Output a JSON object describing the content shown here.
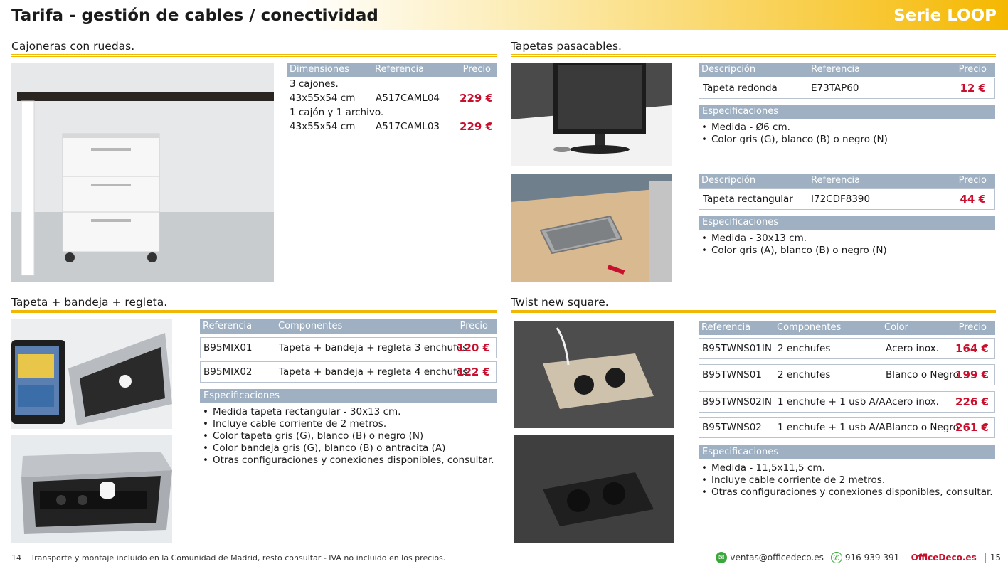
{
  "header": {
    "title": "Tarifa - gestión de cables / conectividad",
    "series": "Serie LOOP"
  },
  "cajoneras": {
    "title": "Cajoneras con ruedas.",
    "headers": {
      "dim": "Dimensiones",
      "ref": "Referencia",
      "price": "Precio"
    },
    "rows": [
      {
        "desc": "3 cajones.",
        "dims": "43x55x54 cm",
        "ref": "A517CAML04",
        "price": "229 €"
      },
      {
        "desc": "1 cajón y 1 archivo.",
        "dims": "43x55x54 cm",
        "ref": "A517CAML03",
        "price": "229 €"
      }
    ]
  },
  "tapetas": {
    "title": "Tapetas pasacables.",
    "headers": {
      "desc": "Descripción",
      "ref": "Referencia",
      "price": "Precio"
    },
    "spec_label": "Especificaciones",
    "items": [
      {
        "desc": "Tapeta redonda",
        "ref": "E73TAP60",
        "price": "12 €",
        "specs": [
          "Medida - Ø6 cm.",
          "Color gris (G), blanco (B) o negro (N)"
        ]
      },
      {
        "desc": "Tapeta rectangular",
        "ref": "I72CDF8390",
        "price": "44 €",
        "specs": [
          "Medida - 30x13 cm.",
          "Color gris (A), blanco (B) o negro (N)"
        ]
      }
    ]
  },
  "bandeja": {
    "title": "Tapeta + bandeja + regleta.",
    "headers": {
      "ref": "Referencia",
      "comp": "Componentes",
      "price": "Precio"
    },
    "rows": [
      {
        "ref": "B95MIX01",
        "comp": "Tapeta + bandeja + regleta 3 enchufes",
        "price": "120 €"
      },
      {
        "ref": "B95MIX02",
        "comp": "Tapeta + bandeja + regleta 4 enchufes",
        "price": "122 €"
      }
    ],
    "spec_label": "Especificaciones",
    "specs": [
      "Medida tapeta rectangular - 30x13 cm.",
      "Incluye cable corriente de 2 metros.",
      "Color tapeta gris (G), blanco (B) o negro (N)",
      "Color bandeja gris (G), blanco (B) o antracita (A)",
      "Otras configuraciones y conexiones disponibles, consultar."
    ]
  },
  "twist": {
    "title": "Twist new square.",
    "headers": {
      "ref": "Referencia",
      "comp": "Componentes",
      "color": "Color",
      "price": "Precio"
    },
    "rows": [
      {
        "ref": "B95TWNS01IN",
        "comp": "2 enchufes",
        "color": "Acero inox.",
        "price": "164 €"
      },
      {
        "ref": "B95TWNS01",
        "comp": "2 enchufes",
        "color": "Blanco o Negro",
        "price": "199 €"
      },
      {
        "ref": "B95TWNS02IN",
        "comp": "1 enchufe + 1 usb A/A",
        "color": "Acero inox.",
        "price": "226 €"
      },
      {
        "ref": "B95TWNS02",
        "comp": "1 enchufe + 1 usb A/A",
        "color": "Blanco o Negro",
        "price": "261 €"
      }
    ],
    "spec_label": "Especificaciones",
    "specs": [
      "Medida - 11,5x11,5 cm.",
      "Incluye cable corriente de 2 metros.",
      "Otras configuraciones y conexiones disponibles, consultar."
    ]
  },
  "footer": {
    "page_left": "14",
    "note": "Transporte y montaje incluido en la Comunidad de Madrid, resto consultar - IVA no incluido en los precios.",
    "email": "ventas@officedeco.es",
    "phone": "916 939 391",
    "dash": "-",
    "brand": "OfficeDeco.es",
    "page_right": "15"
  },
  "colors": {
    "accent": "#f2b705",
    "price": "#c8102e",
    "table_head": "#9fb0c2"
  }
}
